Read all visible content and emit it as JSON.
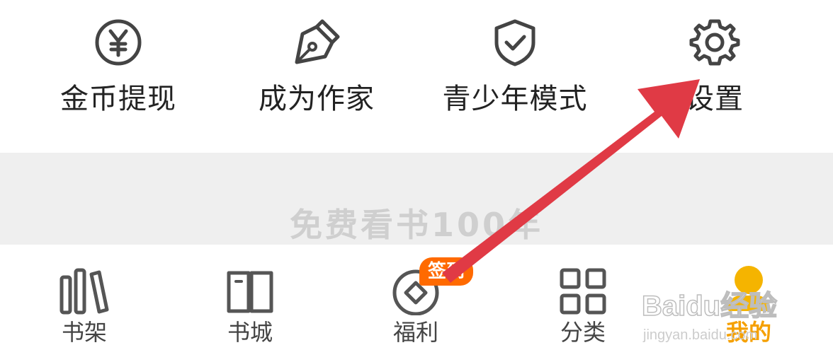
{
  "quick_actions": [
    {
      "label": "金币提现",
      "icon": "yen-coin-icon"
    },
    {
      "label": "成为作家",
      "icon": "pen-nib-icon"
    },
    {
      "label": "青少年模式",
      "icon": "shield-check-icon"
    },
    {
      "label": "设置",
      "icon": "gear-icon"
    }
  ],
  "banner": {
    "text": "免费看书100年"
  },
  "tabs": [
    {
      "label": "书架",
      "icon": "bookshelf-icon"
    },
    {
      "label": "书城",
      "icon": "open-book-icon"
    },
    {
      "label": "福利",
      "icon": "coin-icon",
      "badge": "签到"
    },
    {
      "label": "分类",
      "icon": "grid-icon"
    },
    {
      "label": "我的",
      "icon": "profile-icon",
      "active": true
    }
  ],
  "watermark": {
    "text": "Baidu经验",
    "subtext": "jingyan.baidu.com"
  },
  "colors": {
    "accent": "#f5a000",
    "badge": "#ff6a00",
    "arrow": "#e03a45",
    "icon_stroke": "#444444"
  }
}
